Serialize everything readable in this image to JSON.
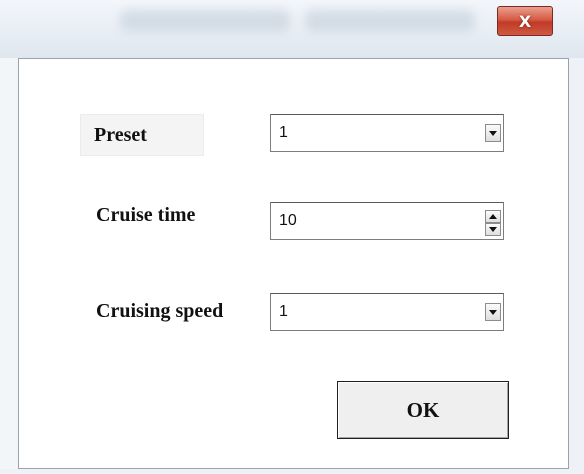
{
  "window": {
    "close_label": "X"
  },
  "form": {
    "preset": {
      "label": "Preset",
      "value": "1"
    },
    "cruise_time": {
      "label": "Cruise time",
      "value": "10"
    },
    "cruising_speed": {
      "label": "Cruising speed",
      "value": "1"
    }
  },
  "buttons": {
    "ok_label": "OK"
  },
  "icons": {
    "close": "close-icon",
    "dropdown": "chevron-down-icon",
    "spin_up": "spin-up-icon",
    "spin_down": "spin-down-icon"
  },
  "colors": {
    "close_button": "#d65a45",
    "background": "#ffffff"
  }
}
